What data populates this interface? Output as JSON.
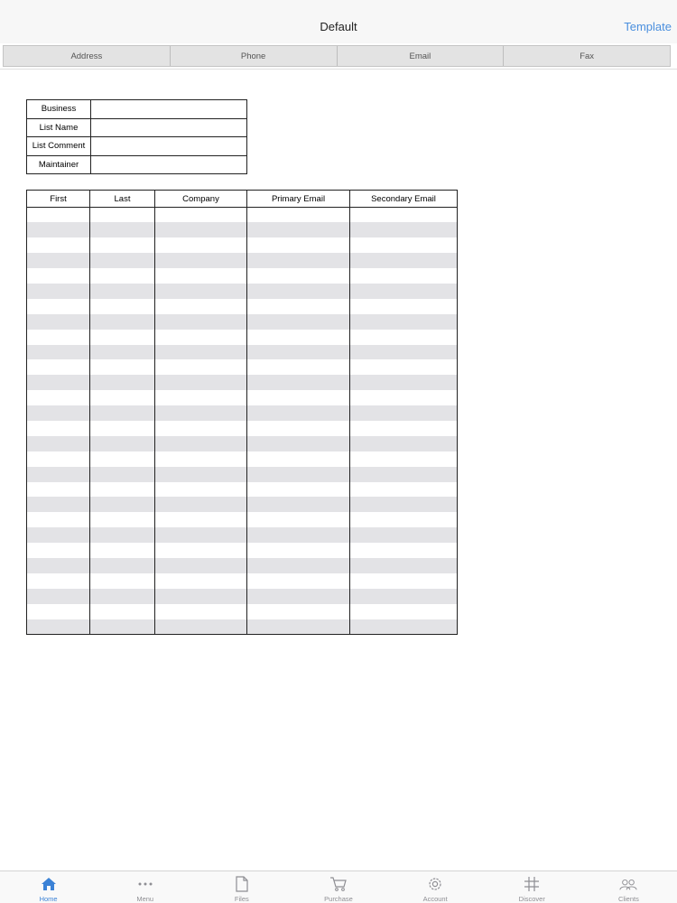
{
  "nav": {
    "title": "Default",
    "right_button": "Template"
  },
  "segments": [
    "Address",
    "Phone",
    "Email",
    "Fax"
  ],
  "info_rows": [
    {
      "label": "Business",
      "value": ""
    },
    {
      "label": "List Name",
      "value": ""
    },
    {
      "label": "List Comment",
      "value": ""
    },
    {
      "label": "Maintainer",
      "value": ""
    }
  ],
  "grid": {
    "columns": [
      "First",
      "Last",
      "Company",
      "Primary Email",
      "Secondary Email"
    ],
    "row_count": 28
  },
  "colors": {
    "accent": "#3b82d6",
    "stripe": "#e3e3e6",
    "segment_bg": "#e3e3e3"
  },
  "tabs": [
    {
      "label": "Home",
      "icon": "home-icon",
      "active": true
    },
    {
      "label": "Menu",
      "icon": "more-icon",
      "active": false
    },
    {
      "label": "Files",
      "icon": "file-icon",
      "active": false
    },
    {
      "label": "Purchase",
      "icon": "cart-icon",
      "active": false
    },
    {
      "label": "Account",
      "icon": "gear-icon",
      "active": false
    },
    {
      "label": "Discover",
      "icon": "hashtag-icon",
      "active": false
    },
    {
      "label": "Clients",
      "icon": "people-icon",
      "active": false
    }
  ]
}
